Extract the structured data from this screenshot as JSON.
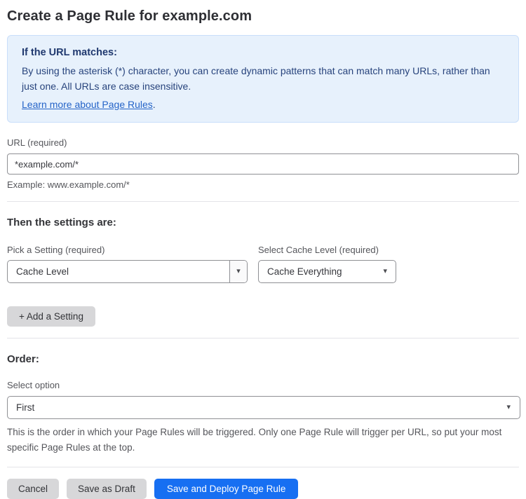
{
  "page": {
    "title": "Create a Page Rule for example.com"
  },
  "info_box": {
    "heading": "If the URL matches:",
    "body": "By using the asterisk (*) character, you can create dynamic patterns that can match many URLs, rather than just one. All URLs are case insensitive.",
    "link_label": "Learn more about Page Rules",
    "link_suffix": "."
  },
  "url_field": {
    "label": "URL (required)",
    "value": "*example.com/*",
    "helper": "Example: www.example.com/*"
  },
  "settings_section": {
    "heading": "Then the settings are:",
    "setting_picker": {
      "label": "Pick a Setting (required)",
      "selected": "Cache Level"
    },
    "cache_level_picker": {
      "label": "Select Cache Level (required)",
      "selected": "Cache Everything"
    },
    "add_setting_label": "+ Add a Setting"
  },
  "order_section": {
    "heading": "Order:",
    "select_label": "Select option",
    "selected": "First",
    "helper": "This is the order in which your Page Rules will be triggered. Only one Page Rule will trigger per URL, so put your most specific Page Rules at the top."
  },
  "actions": {
    "cancel_label": "Cancel",
    "save_draft_label": "Save as Draft",
    "save_deploy_label": "Save and Deploy Page Rule"
  },
  "icons": {
    "dropdown_arrow": "▾"
  },
  "colors": {
    "accent_blue": "#176ff2",
    "info_box_background": "#e7f1fc",
    "info_box_border": "#c9defa",
    "info_box_text": "#27437c",
    "link_blue": "#2564c8",
    "gray_button_background": "#d7d7d9",
    "label_gray": "#55565b"
  }
}
